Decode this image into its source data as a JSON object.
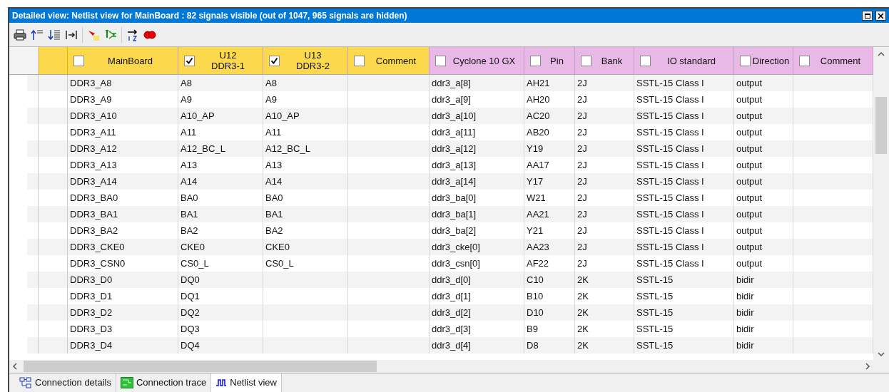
{
  "window": {
    "title": "Detailed view: Netlist view for MainBoard : 82 signals visible (out of 1047, 965 signals are hidden)"
  },
  "columns": [
    {
      "kind": "board",
      "lines": [
        "MainBoard"
      ],
      "checked": false
    },
    {
      "kind": "board",
      "lines": [
        "U12",
        "DDR3-1"
      ],
      "checked": true
    },
    {
      "kind": "board",
      "lines": [
        "U13",
        "DDR3-2"
      ],
      "checked": true
    },
    {
      "kind": "board",
      "lines": [
        "Comment"
      ],
      "checked": false
    },
    {
      "kind": "fpga",
      "lines": [
        "Cyclone 10 GX"
      ],
      "checked": false
    },
    {
      "kind": "fpga",
      "lines": [
        "Pin"
      ],
      "checked": false
    },
    {
      "kind": "fpga",
      "lines": [
        "Bank"
      ],
      "checked": false
    },
    {
      "kind": "fpga",
      "lines": [
        "IO standard"
      ],
      "checked": false
    },
    {
      "kind": "fpga",
      "lines": [
        "Direction"
      ],
      "checked": false
    },
    {
      "kind": "fpga",
      "lines": [
        "Comment"
      ],
      "checked": false
    }
  ],
  "rows": [
    [
      "DDR3_A8",
      "A8",
      "A8",
      "",
      "ddr3_a[8]",
      "AH21",
      "2J",
      "SSTL-15 Class I",
      "output",
      ""
    ],
    [
      "DDR3_A9",
      "A9",
      "A9",
      "",
      "ddr3_a[9]",
      "AH20",
      "2J",
      "SSTL-15 Class I",
      "output",
      ""
    ],
    [
      "DDR3_A10",
      "A10_AP",
      "A10_AP",
      "",
      "ddr3_a[10]",
      "AC20",
      "2J",
      "SSTL-15 Class I",
      "output",
      ""
    ],
    [
      "DDR3_A11",
      "A11",
      "A11",
      "",
      "ddr3_a[11]",
      "AB20",
      "2J",
      "SSTL-15 Class I",
      "output",
      ""
    ],
    [
      "DDR3_A12",
      "A12_BC_L",
      "A12_BC_L",
      "",
      "ddr3_a[12]",
      "Y19",
      "2J",
      "SSTL-15 Class I",
      "output",
      ""
    ],
    [
      "DDR3_A13",
      "A13",
      "A13",
      "",
      "ddr3_a[13]",
      "AA17",
      "2J",
      "SSTL-15 Class I",
      "output",
      ""
    ],
    [
      "DDR3_A14",
      "A14",
      "A14",
      "",
      "ddr3_a[14]",
      "Y17",
      "2J",
      "SSTL-15 Class I",
      "output",
      ""
    ],
    [
      "DDR3_BA0",
      "BA0",
      "BA0",
      "",
      "ddr3_ba[0]",
      "W21",
      "2J",
      "SSTL-15 Class I",
      "output",
      ""
    ],
    [
      "DDR3_BA1",
      "BA1",
      "BA1",
      "",
      "ddr3_ba[1]",
      "AA21",
      "2J",
      "SSTL-15 Class I",
      "output",
      ""
    ],
    [
      "DDR3_BA2",
      "BA2",
      "BA2",
      "",
      "ddr3_ba[2]",
      "Y21",
      "2J",
      "SSTL-15 Class I",
      "output",
      ""
    ],
    [
      "DDR3_CKE0",
      "CKE0",
      "CKE0",
      "",
      "ddr3_cke[0]",
      "AA23",
      "2J",
      "SSTL-15 Class I",
      "output",
      ""
    ],
    [
      "DDR3_CSN0",
      "CS0_L",
      "CS0_L",
      "",
      "ddr3_csn[0]",
      "AF22",
      "2J",
      "SSTL-15 Class I",
      "output",
      ""
    ],
    [
      "DDR3_D0",
      "DQ0",
      "",
      "",
      "ddr3_d[0]",
      "C10",
      "2K",
      "SSTL-15",
      "bidir",
      ""
    ],
    [
      "DDR3_D1",
      "DQ1",
      "",
      "",
      "ddr3_d[1]",
      "B10",
      "2K",
      "SSTL-15",
      "bidir",
      ""
    ],
    [
      "DDR3_D2",
      "DQ2",
      "",
      "",
      "ddr3_d[2]",
      "D10",
      "2K",
      "SSTL-15",
      "bidir",
      ""
    ],
    [
      "DDR3_D3",
      "DQ3",
      "",
      "",
      "ddr3_d[3]",
      "B9",
      "2K",
      "SSTL-15",
      "bidir",
      ""
    ],
    [
      "DDR3_D4",
      "DQ4",
      "",
      "",
      "ddr3_d[4]",
      "D8",
      "2K",
      "SSTL-15",
      "bidir",
      ""
    ]
  ],
  "tabs": [
    {
      "label": "Connection details",
      "selected": false
    },
    {
      "label": "Connection trace",
      "selected": false
    },
    {
      "label": "Netlist view",
      "selected": true
    }
  ]
}
